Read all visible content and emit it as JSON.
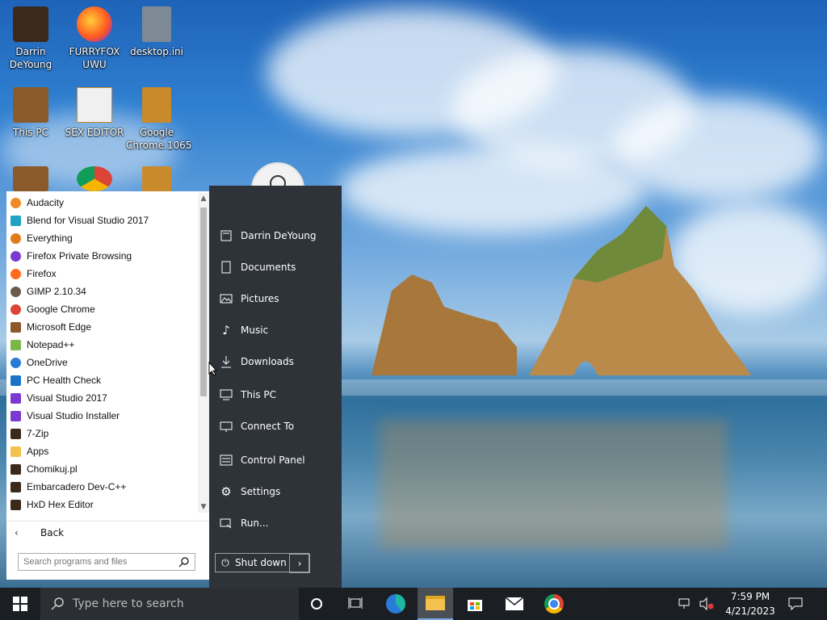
{
  "desktop": {
    "icons": [
      {
        "label": "Darrin DeYoung"
      },
      {
        "label": "FURRYFOX UWU"
      },
      {
        "label": "desktop.ini"
      },
      {
        "label": "This PC"
      },
      {
        "label": "SEX EDITOR"
      },
      {
        "label": "Google Chrome.1065"
      }
    ]
  },
  "start_menu": {
    "programs": [
      {
        "label": "Audacity"
      },
      {
        "label": "Blend for Visual Studio 2017"
      },
      {
        "label": "Everything"
      },
      {
        "label": "Firefox Private Browsing"
      },
      {
        "label": "Firefox"
      },
      {
        "label": "GIMP 2.10.34"
      },
      {
        "label": "Google Chrome"
      },
      {
        "label": "Microsoft Edge"
      },
      {
        "label": "Notepad++"
      },
      {
        "label": "OneDrive"
      },
      {
        "label": "PC Health Check"
      },
      {
        "label": "Visual Studio 2017"
      },
      {
        "label": "Visual Studio Installer"
      },
      {
        "label": "7-Zip"
      },
      {
        "label": "Apps"
      },
      {
        "label": "Chomikuj.pl"
      },
      {
        "label": "Embarcadero Dev-C++"
      },
      {
        "label": "HxD Hex Editor"
      }
    ],
    "back_label": "Back",
    "search_placeholder": "Search programs and files",
    "right_items": [
      {
        "label": "Darrin DeYoung"
      },
      {
        "label": "Documents"
      },
      {
        "label": "Pictures"
      },
      {
        "label": "Music"
      },
      {
        "label": "Downloads"
      },
      {
        "label": "This PC"
      },
      {
        "label": "Connect To"
      },
      {
        "label": "Control Panel"
      },
      {
        "label": "Settings"
      },
      {
        "label": "Run..."
      }
    ],
    "shutdown_label": "Shut down"
  },
  "taskbar": {
    "search_placeholder": "Type here to search",
    "time": "7:59 PM",
    "date": "4/21/2023"
  },
  "colors": {
    "taskbar": "#1b1f24",
    "start_right": "#2d3338",
    "accent": "#7aa9e0"
  }
}
